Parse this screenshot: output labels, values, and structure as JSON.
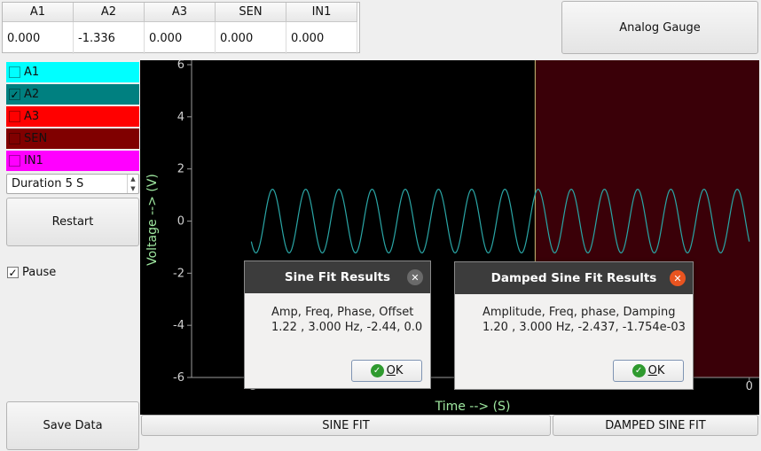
{
  "readings": {
    "headers": [
      "A1",
      "A2",
      "A3",
      "SEN",
      "IN1"
    ],
    "values": [
      "0.000",
      "-1.336",
      "0.000",
      "0.000",
      "0.000"
    ]
  },
  "analog_gauge_label": "Analog Gauge",
  "channels": [
    {
      "label": "A1",
      "checked": false,
      "color": "#00ffff"
    },
    {
      "label": "A2",
      "checked": true,
      "color": "#008080"
    },
    {
      "label": "A3",
      "checked": false,
      "color": "#ff0000"
    },
    {
      "label": "SEN",
      "checked": false,
      "color": "#800000"
    },
    {
      "label": "IN1",
      "checked": false,
      "color": "#ff00ff"
    }
  ],
  "duration_value": "Duration 5 S",
  "restart_label": "Restart",
  "pause": {
    "label": "Pause",
    "checked": true
  },
  "save_label": "Save Data",
  "sine_fit_label": "SINE FIT",
  "damped_sine_fit_label": "DAMPED SINE FIT",
  "plot": {
    "ylabel": "Voltage --> (V)",
    "xlabel": "Time --> (S)",
    "y_ticks": [
      "6",
      "4",
      "2",
      "0",
      "-2",
      "-4",
      "-6"
    ],
    "x_ticks_visible": [
      "-5",
      "0"
    ],
    "background": "#000000",
    "trace_color": "#2aa6a6",
    "region_color": "#3a0008",
    "region_line_color": "#c9c077"
  },
  "chart_data": {
    "type": "line",
    "title": "",
    "xlabel": "Time --> (S)",
    "ylabel": "Voltage --> (V)",
    "xlim": [
      -5.6,
      0.1
    ],
    "ylim": [
      -6,
      6
    ],
    "series": [
      {
        "name": "A2",
        "amplitude": 1.22,
        "frequency_hz": 3.0,
        "phase": -2.44,
        "offset": 0.0,
        "x_start": -5.0,
        "x_end": 0.0
      }
    ],
    "selected_region": [
      -2.15,
      0.35
    ]
  },
  "dialogs": {
    "sine": {
      "title": "Sine Fit Results",
      "line1": "Amp, Freq, Phase, Offset",
      "line2": "1.22 , 3.000 Hz, -2.44, 0.0",
      "ok_first": "O",
      "ok_rest": "K"
    },
    "damped": {
      "title": "Damped Sine Fit Results",
      "line1": "Amplitude, Freq, phase, Damping",
      "line2": "1.20 , 3.000 Hz, -2.437, -1.754e-03",
      "ok_first": "O",
      "ok_rest": "K"
    }
  }
}
